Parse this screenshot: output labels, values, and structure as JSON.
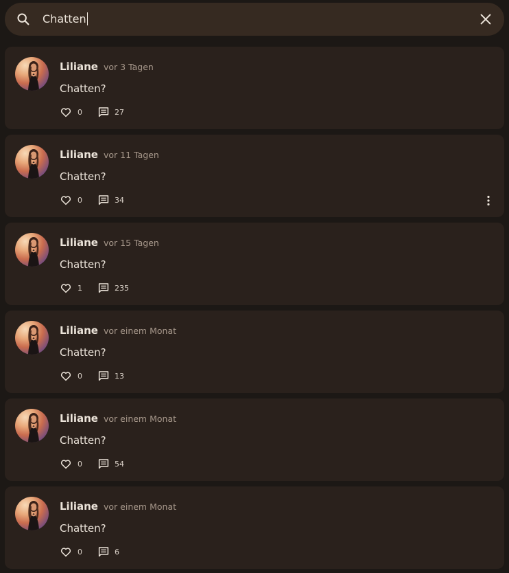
{
  "search": {
    "query": "Chatten",
    "search_icon": "search-icon",
    "clear_icon": "close-icon"
  },
  "colors": {
    "background": "#1c1815",
    "search_bar": "#362a21",
    "card": "#2a211c",
    "text": "#ece4da",
    "muted": "#a8998c"
  },
  "posts": [
    {
      "author": "Liliane",
      "time": "vor 3 Tagen",
      "text": "Chatten?",
      "likes": "0",
      "comments": "27",
      "has_menu": false
    },
    {
      "author": "Liliane",
      "time": "vor 11 Tagen",
      "text": "Chatten?",
      "likes": "0",
      "comments": "34",
      "has_menu": true
    },
    {
      "author": "Liliane",
      "time": "vor 15 Tagen",
      "text": "Chatten?",
      "likes": "1",
      "comments": "235",
      "has_menu": false
    },
    {
      "author": "Liliane",
      "time": "vor einem Monat",
      "text": "Chatten?",
      "likes": "0",
      "comments": "13",
      "has_menu": false
    },
    {
      "author": "Liliane",
      "time": "vor einem Monat",
      "text": "Chatten?",
      "likes": "0",
      "comments": "54",
      "has_menu": false
    },
    {
      "author": "Liliane",
      "time": "vor einem Monat",
      "text": "Chatten?",
      "likes": "0",
      "comments": "6",
      "has_menu": false
    }
  ],
  "icons": {
    "like": "heart-icon",
    "comment": "comment-icon",
    "more": "more-vertical-icon"
  }
}
